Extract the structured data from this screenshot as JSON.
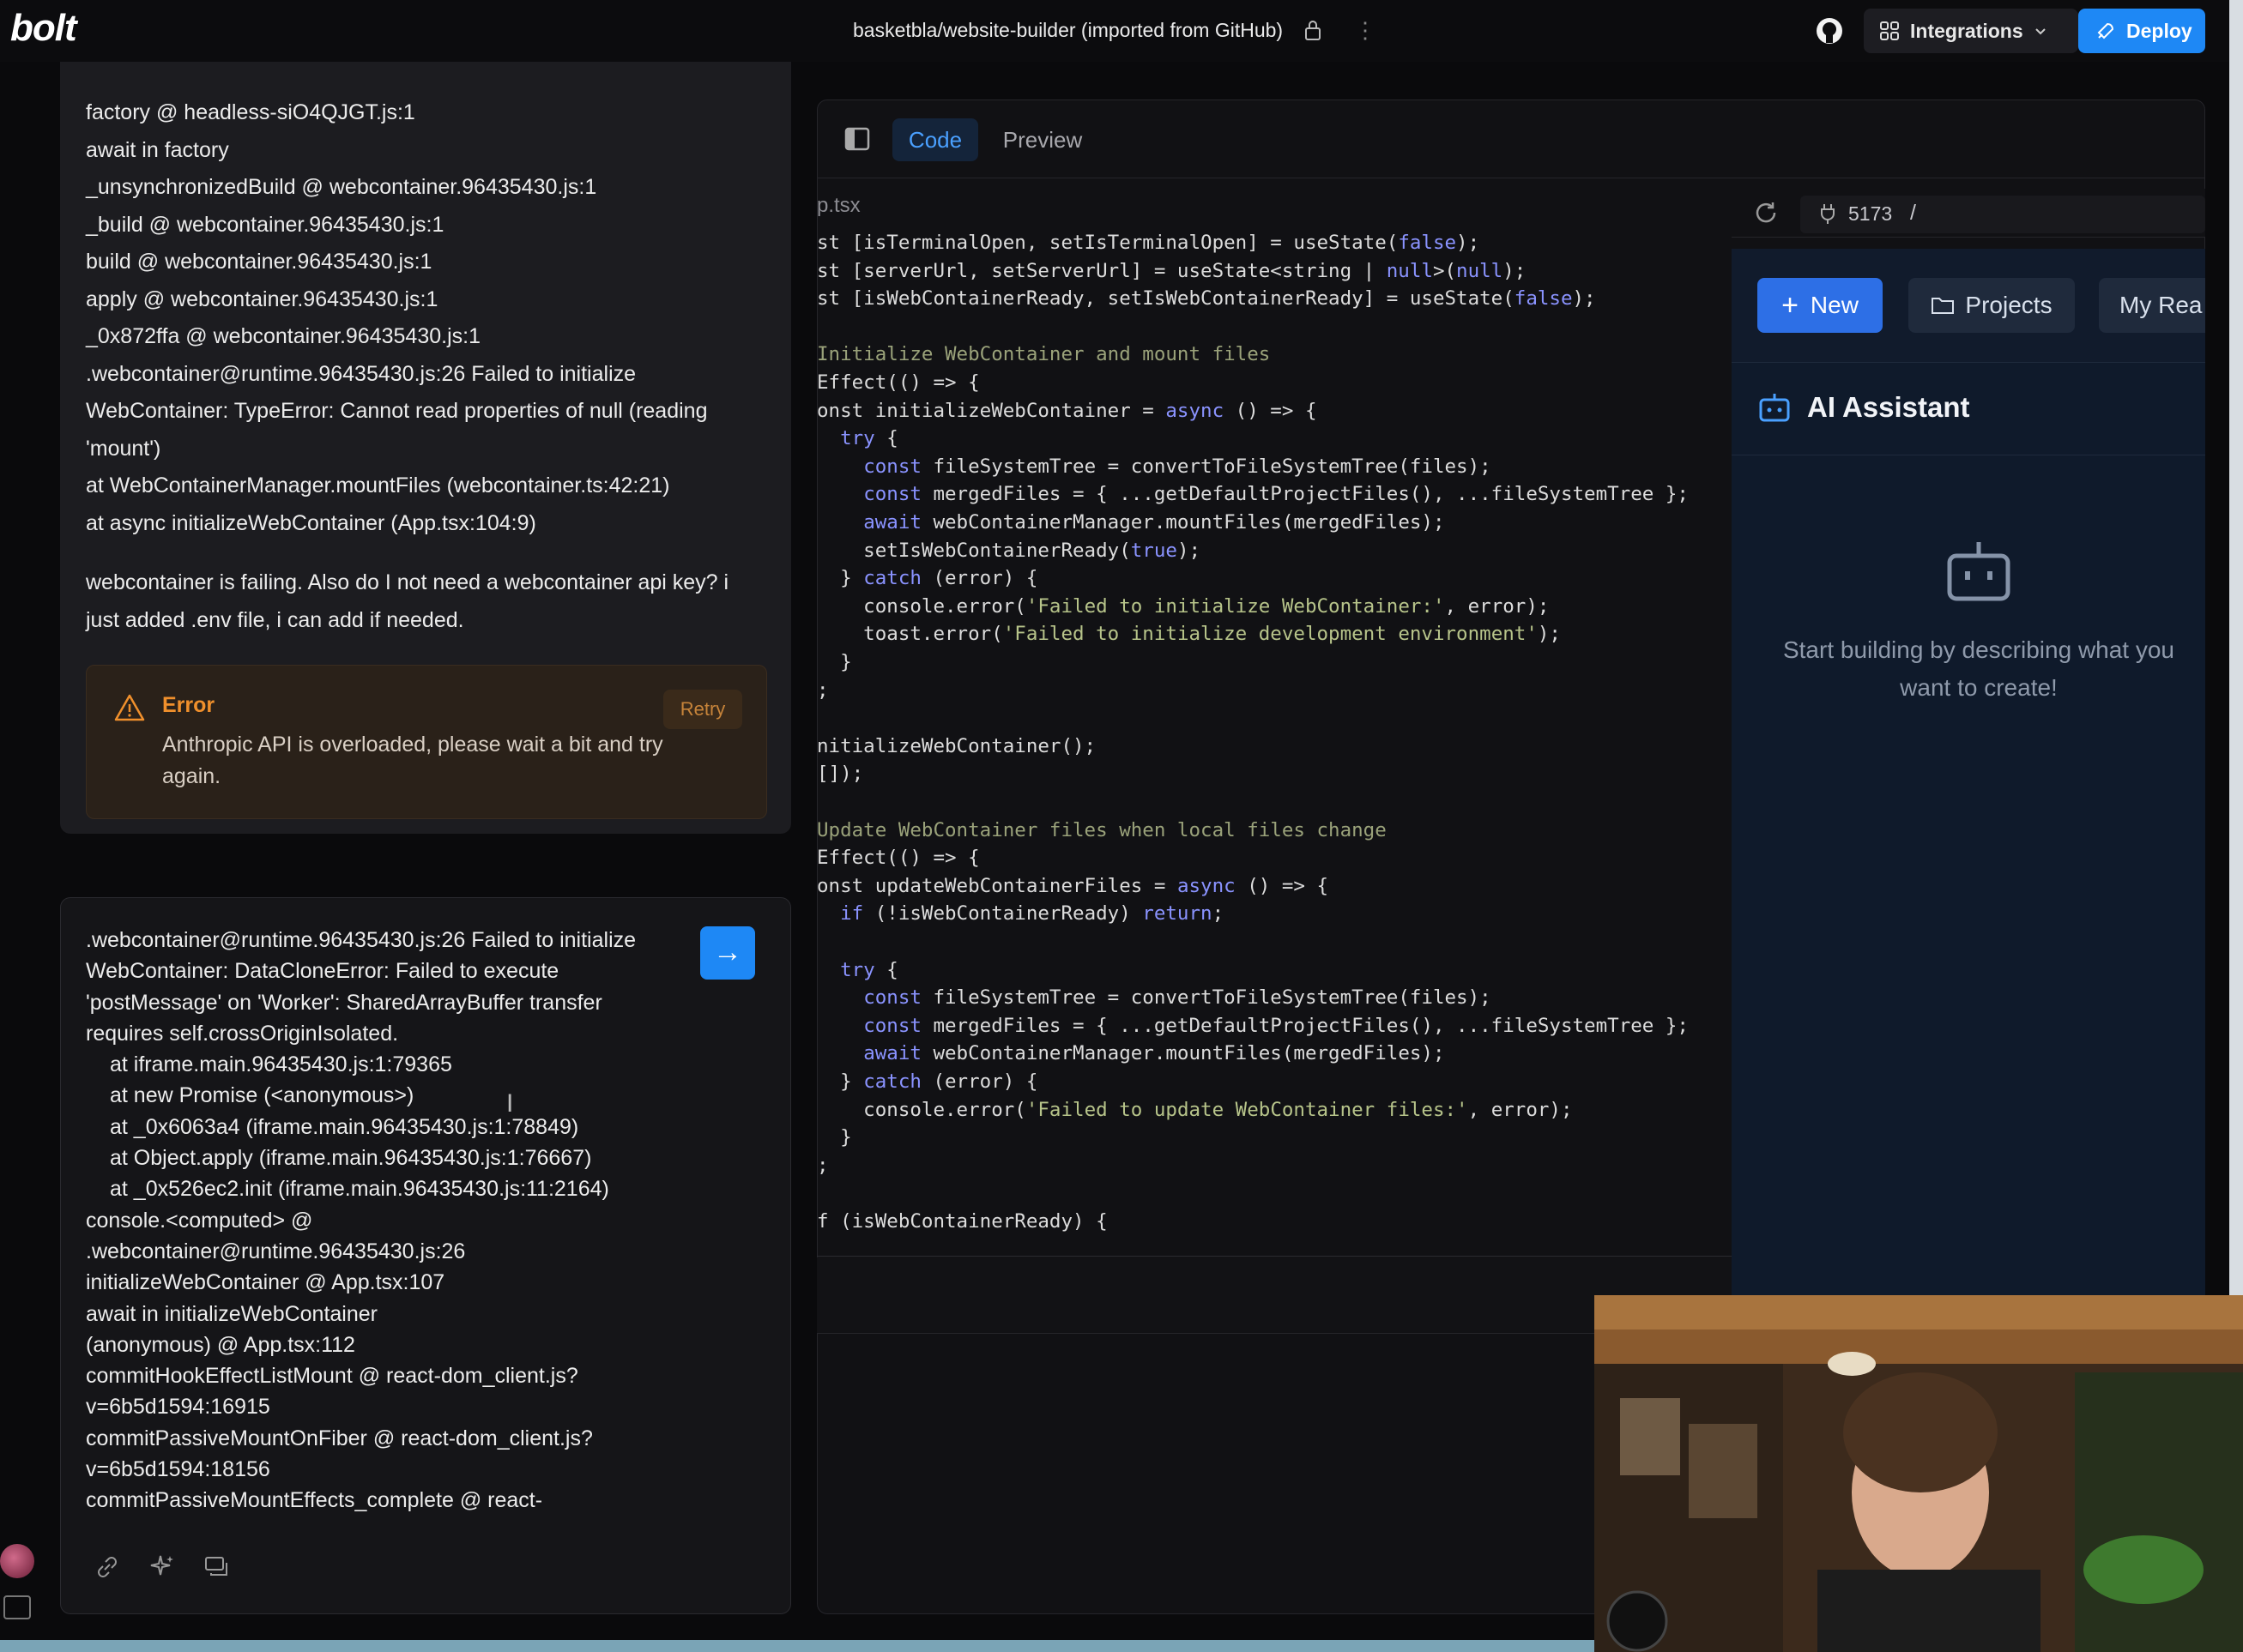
{
  "header": {
    "logo": "bolt",
    "repo_title": "basketbla/website-builder (imported from GitHub)",
    "integrations_label": "Integrations",
    "deploy_label": "Deploy"
  },
  "chat": {
    "log_lines": [
      "factory @ headless-siO4QJGT.js:1",
      "await in factory",
      "_unsynchronizedBuild @ webcontainer.96435430.js:1",
      "_build @ webcontainer.96435430.js:1",
      "build @ webcontainer.96435430.js:1",
      "apply @ webcontainer.96435430.js:1",
      "_0x872ffa @ webcontainer.96435430.js:1",
      ".webcontainer@runtime.96435430.js:26 Failed to initialize",
      "WebContainer: TypeError: Cannot read properties of null (reading",
      "'mount')",
      "at WebContainerManager.mountFiles (webcontainer.ts:42:21)",
      "at async initializeWebContainer (App.tsx:104:9)"
    ],
    "user_message": "webcontainer is failing. Also do I not need a webcontainer api key? i just added .env file, i can add if needed.",
    "error": {
      "title": "Error",
      "body": "Anthropic API is overloaded, please wait a bit and try again.",
      "retry_label": "Retry"
    }
  },
  "input": {
    "lines": [
      {
        "text": ".webcontainer@runtime.96435430.js:26 Failed to initialize",
        "indent": false
      },
      {
        "text": "WebContainer: DataCloneError: Failed to execute",
        "indent": false
      },
      {
        "text": "'postMessage' on 'Worker': SharedArrayBuffer transfer",
        "indent": false
      },
      {
        "text": "requires self.crossOriginIsolated.",
        "indent": false
      },
      {
        "text": "at iframe.main.96435430.js:1:79365",
        "indent": true
      },
      {
        "text": "at new Promise (<anonymous>)",
        "indent": true
      },
      {
        "text": "at _0x6063a4 (iframe.main.96435430.js:1:78849)",
        "indent": true
      },
      {
        "text": "at Object.apply (iframe.main.96435430.js:1:76667)",
        "indent": true
      },
      {
        "text": "at _0x526ec2.init (iframe.main.96435430.js:11:2164)",
        "indent": true
      },
      {
        "text": "console.<computed> @",
        "indent": false
      },
      {
        "text": ".webcontainer@runtime.96435430.js:26",
        "indent": false
      },
      {
        "text": "initializeWebContainer @ App.tsx:107",
        "indent": false
      },
      {
        "text": "await in initializeWebContainer",
        "indent": false
      },
      {
        "text": "(anonymous) @ App.tsx:112",
        "indent": false
      },
      {
        "text": "commitHookEffectListMount @ react-dom_client.js?",
        "indent": false
      },
      {
        "text": "v=6b5d1594:16915",
        "indent": false
      },
      {
        "text": "commitPassiveMountOnFiber @ react-dom_client.js?",
        "indent": false
      },
      {
        "text": "v=6b5d1594:18156",
        "indent": false
      },
      {
        "text": "commitPassiveMountEffects_complete @ react-",
        "indent": false
      }
    ]
  },
  "workbench": {
    "tab_code": "Code",
    "tab_preview": "Preview",
    "file_tab": "p.tsx",
    "code_lines": [
      "st [isTerminalOpen, setIsTerminalOpen] = useState(false);",
      "st [serverUrl, setServerUrl] = useState<string | null>(null);",
      "st [isWebContainerReady, setIsWebContainerReady] = useState(false);",
      "",
      "Initialize WebContainer and mount files",
      "Effect(() => {",
      "onst initializeWebContainer = async () => {",
      "  try {",
      "    const fileSystemTree = convertToFileSystemTree(files);",
      "    const mergedFiles = { ...getDefaultProjectFiles(), ...fileSystemTree };",
      "    await webContainerManager.mountFiles(mergedFiles);",
      "    setIsWebContainerReady(true);",
      "  } catch (error) {",
      "    console.error('Failed to initialize WebContainer:', error);",
      "    toast.error('Failed to initialize development environment');",
      "  }",
      ";",
      "",
      "nitializeWebContainer();",
      "[]);",
      "",
      "Update WebContainer files when local files change",
      "Effect(() => {",
      "onst updateWebContainerFiles = async () => {",
      "  if (!isWebContainerReady) return;",
      "",
      "  try {",
      "    const fileSystemTree = convertToFileSystemTree(files);",
      "    const mergedFiles = { ...getDefaultProjectFiles(), ...fileSystemTree };",
      "    await webContainerManager.mountFiles(mergedFiles);",
      "  } catch (error) {",
      "    console.error('Failed to update WebContainer files:', error);",
      "  }",
      ";",
      "",
      "f (isWebContainerReady) {"
    ]
  },
  "preview": {
    "port": "5173",
    "path": "/",
    "new_label": "New",
    "projects_label": "Projects",
    "my_label": "My Rea",
    "ai_title": "AI Assistant",
    "empty_text": "Start building by describing what you want to create!"
  },
  "colors": {
    "accent": "#1e88f5",
    "error_orange": "#f0902c",
    "preview_bg": "#0f1a2b"
  }
}
